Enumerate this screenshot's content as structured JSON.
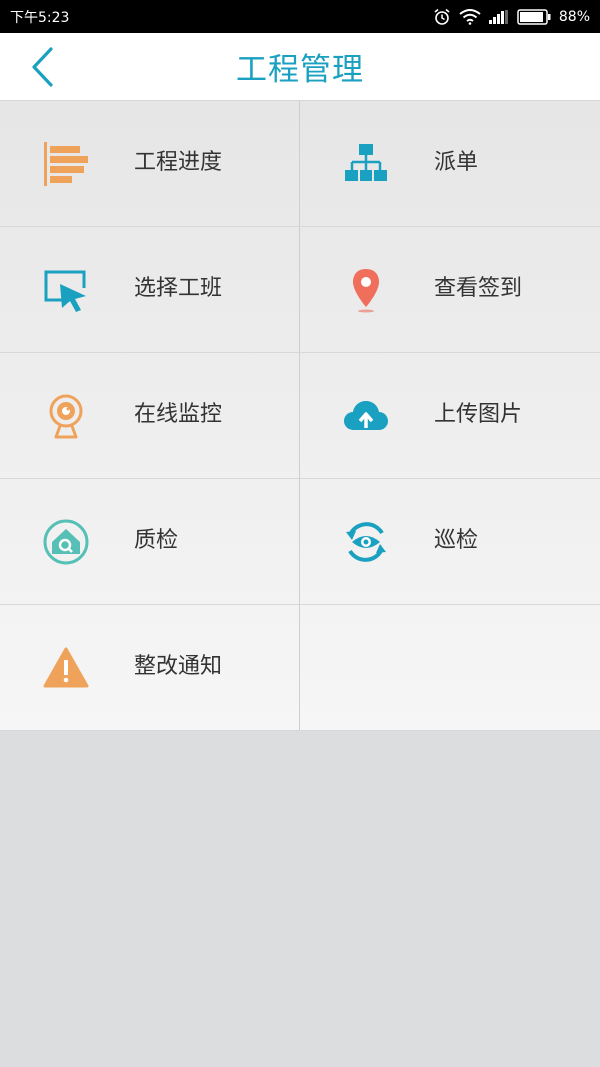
{
  "status": {
    "time": "下午5:23",
    "battery": "88%"
  },
  "header": {
    "title": "工程管理"
  },
  "menu": [
    {
      "label": "工程进度",
      "icon": "progress-bars-icon"
    },
    {
      "label": "派单",
      "icon": "org-chart-icon"
    },
    {
      "label": "选择工班",
      "icon": "cursor-screen-icon"
    },
    {
      "label": "查看签到",
      "icon": "location-pin-icon"
    },
    {
      "label": "在线监控",
      "icon": "webcam-icon"
    },
    {
      "label": "上传图片",
      "icon": "cloud-upload-icon"
    },
    {
      "label": "质检",
      "icon": "house-search-icon"
    },
    {
      "label": "巡检",
      "icon": "eye-refresh-icon"
    },
    {
      "label": "整改通知",
      "icon": "warning-icon"
    }
  ],
  "colors": {
    "accent": "#1aa0c0",
    "orange": "#efa25a",
    "teal": "#56c0b6",
    "pin": "#ef6e5c"
  }
}
